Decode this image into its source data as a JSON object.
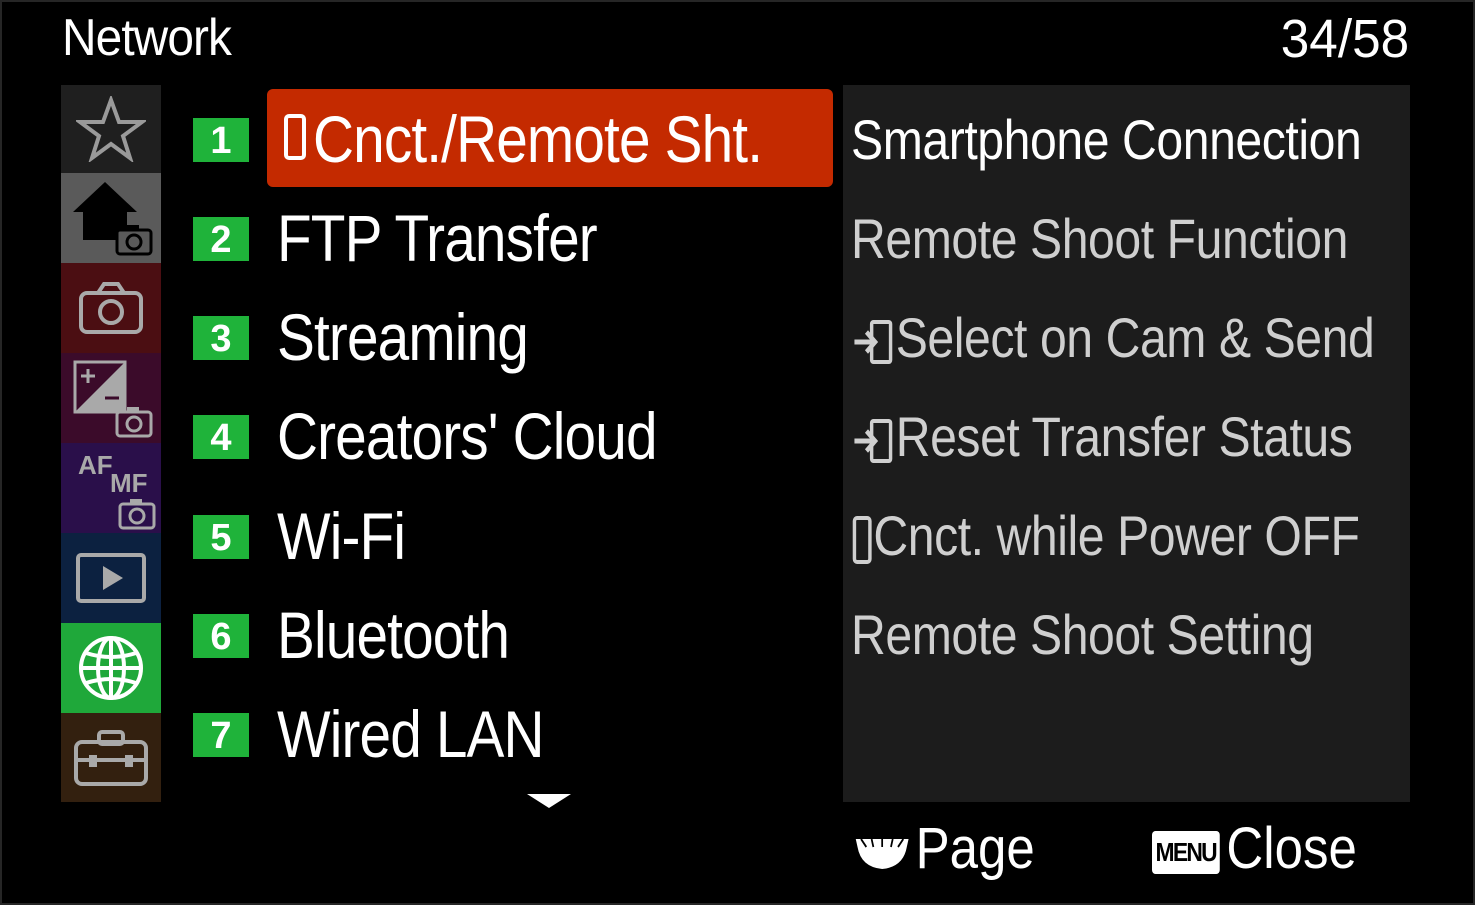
{
  "header": {
    "title": "Network",
    "page_counter": "34/58"
  },
  "sidebar": {
    "tabs": [
      {
        "name": "my-menu",
        "icon": "star-icon",
        "bg": "#1f1f1f",
        "active": false
      },
      {
        "name": "main-shooting",
        "icon": "home-camera-icon",
        "bg": "#5a5a5a",
        "active": false
      },
      {
        "name": "shooting",
        "icon": "camera-icon",
        "bg": "#4b0e12",
        "active": false
      },
      {
        "name": "exposure-color",
        "icon": "exposure-camera-icon",
        "bg": "#3b0b2a",
        "active": false
      },
      {
        "name": "focus",
        "icon": "af-mf-camera-icon",
        "bg": "#2a0f4a",
        "active": false,
        "text_af": "AF",
        "text_mf": "MF"
      },
      {
        "name": "playback",
        "icon": "play-icon",
        "bg": "#0c2140",
        "active": false
      },
      {
        "name": "network",
        "icon": "globe-icon",
        "bg": "#1fa83a",
        "active": true
      },
      {
        "name": "setup",
        "icon": "toolbox-icon",
        "bg": "#33200f",
        "active": false
      }
    ]
  },
  "menu": {
    "items": [
      {
        "num": "1",
        "label": "Cnct./Remote Sht.",
        "selected": true,
        "has_phone_icon": true
      },
      {
        "num": "2",
        "label": "FTP Transfer",
        "selected": false
      },
      {
        "num": "3",
        "label": "Streaming",
        "selected": false
      },
      {
        "num": "4",
        "label": "Creators' Cloud",
        "selected": false
      },
      {
        "num": "5",
        "label": "Wi-Fi",
        "selected": false
      },
      {
        "num": "6",
        "label": "Bluetooth",
        "selected": false
      },
      {
        "num": "7",
        "label": "Wired LAN",
        "selected": false
      }
    ],
    "more_below": true
  },
  "submenu": {
    "items": [
      {
        "label": "Smartphone Connection",
        "glyph": "",
        "bright": true
      },
      {
        "label": "Remote Shoot Function",
        "glyph": "",
        "bright": false
      },
      {
        "label": "Select on Cam & Send",
        "glyph": "transfer-icon",
        "bright": false
      },
      {
        "label": "Reset Transfer Status",
        "glyph": "transfer-icon",
        "bright": false
      },
      {
        "label": "Cnct. while Power OFF",
        "glyph": "phone-icon",
        "bright": false
      },
      {
        "label": "Remote Shoot Setting",
        "glyph": "",
        "bright": false
      }
    ]
  },
  "footer": {
    "page_label": "Page",
    "menu_key": "MENU",
    "close_label": "Close"
  },
  "colors": {
    "selected": "#c42a00",
    "number_badge": "#1fb33a",
    "panel": "#1c1c1c"
  }
}
